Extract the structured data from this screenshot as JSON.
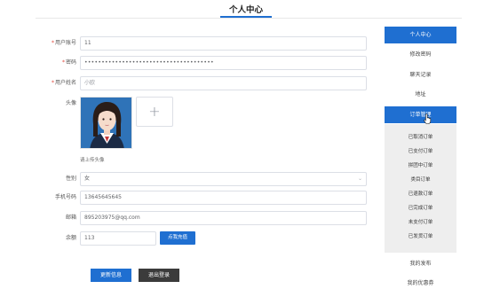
{
  "header": {
    "title": "个人中心"
  },
  "form": {
    "account": {
      "label": "用户账号",
      "value": "11"
    },
    "password": {
      "label": "密码",
      "value": "••••••••••••••••••••••••••••••••••••••"
    },
    "name": {
      "label": "用户姓名",
      "placeholder": "小欧"
    },
    "avatar": {
      "label": "头像",
      "hint": "请上传头像"
    },
    "gender": {
      "label": "性别",
      "value": "女"
    },
    "phone": {
      "label": "手机号码",
      "value": "13645645645"
    },
    "email": {
      "label": "邮箱",
      "value": "895203975@qq.com"
    },
    "balance": {
      "label": "余额",
      "value": "113",
      "button": "点我充值"
    },
    "required_mark": "*"
  },
  "actions": {
    "update": "更新信息",
    "logout": "退出登录"
  },
  "sidebar": {
    "items": [
      {
        "label": "个人中心"
      },
      {
        "label": "修改密码"
      },
      {
        "label": "聊天记录"
      },
      {
        "label": "地址"
      },
      {
        "label": "订单管理"
      }
    ],
    "order_sub": [
      {
        "label": "已取消订单"
      },
      {
        "label": "已支付订单"
      },
      {
        "label": "拼团中订单"
      },
      {
        "label": "类目订单"
      },
      {
        "label": "已退款订单"
      },
      {
        "label": "已完成订单"
      },
      {
        "label": "未支付订单"
      },
      {
        "label": "已发货订单"
      }
    ],
    "bottom": [
      {
        "label": "我的发布"
      },
      {
        "label": "我的优惠券"
      }
    ]
  },
  "colors": {
    "accent": "#1f6fd1",
    "dark_button": "#3b3b3b",
    "required": "#e0463c"
  }
}
